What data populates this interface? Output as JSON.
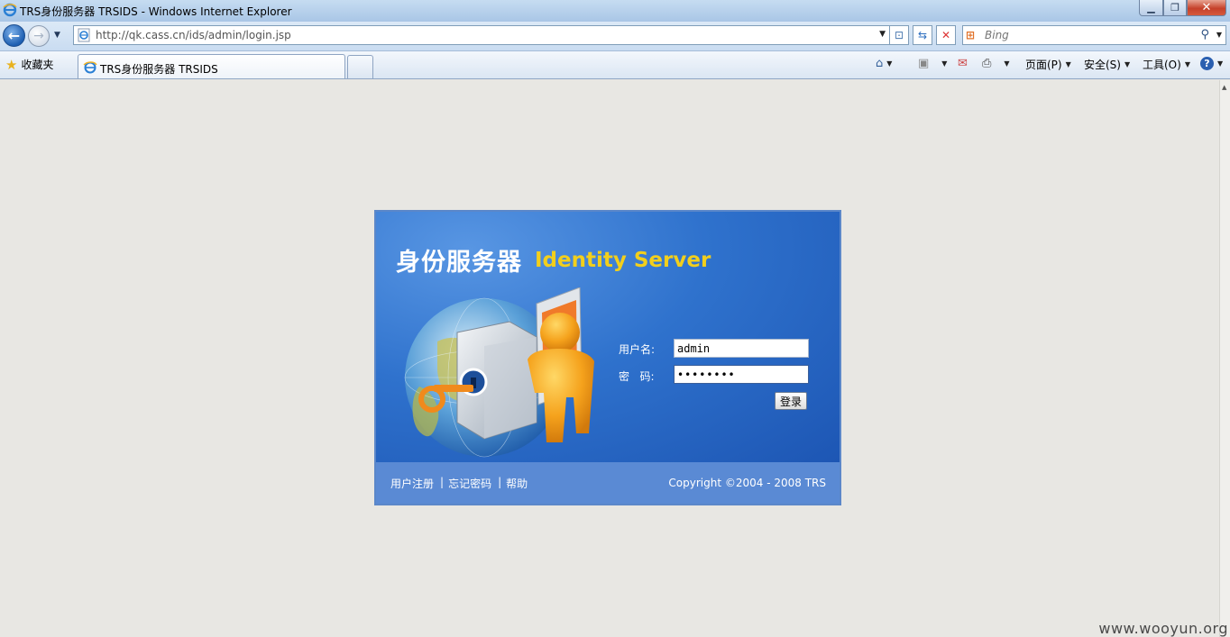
{
  "window": {
    "title": "TRS身份服务器 TRSIDS - Windows Internet Explorer",
    "minimize": "▁",
    "maximize": "❐",
    "close": "✕"
  },
  "navigation": {
    "back_icon": "arrow-left-icon",
    "forward_icon": "arrow-right-icon",
    "url": "http://qk.cass.cn/ids/admin/login.jsp",
    "search_engine": "Bing",
    "search_placeholder": "Bing"
  },
  "favorites": {
    "label": "收藏夹"
  },
  "tabs": [
    {
      "label": "TRS身份服务器 TRSIDS",
      "active": true
    }
  ],
  "command_bar": {
    "page_label": "页面(P)",
    "safety_label": "安全(S)",
    "tools_label": "工具(O)"
  },
  "login": {
    "title_cn": "身份服务器",
    "title_en": "Identity Server",
    "username_label": "用户名:",
    "username_value": "admin",
    "password_label": "密   码:",
    "password_value": "••••••••",
    "submit_label": "登录"
  },
  "footer": {
    "links": [
      "用户注册",
      "忘记密码",
      "帮助"
    ],
    "separator": "|",
    "copyright": "Copyright ©2004 - 2008 TRS"
  },
  "watermark": "www.wooyun.org",
  "colors": {
    "panel_blue": "#2c6cc7",
    "footer_blue": "#5a8ad4",
    "title_yellow": "#f2cf1c",
    "page_bg": "#e8e7e3"
  }
}
